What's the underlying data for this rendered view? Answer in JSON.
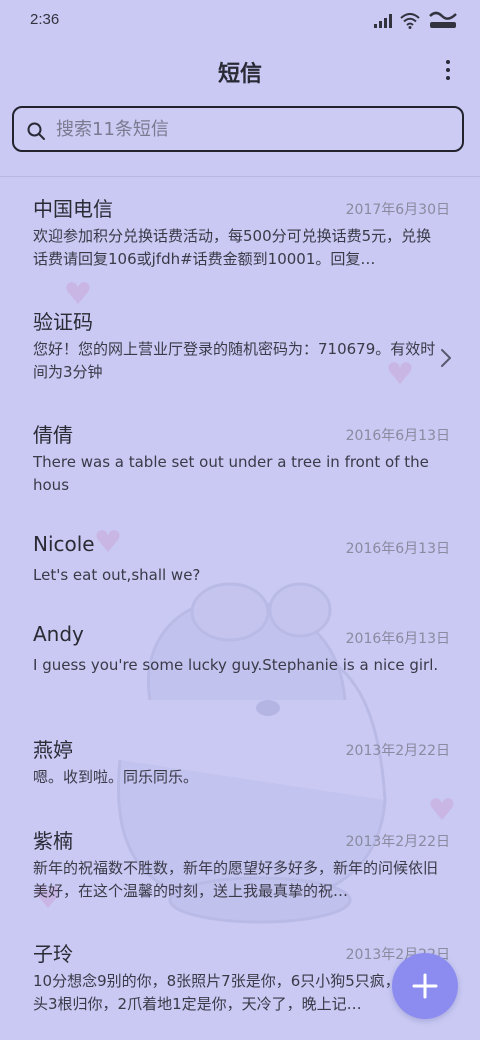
{
  "status_bar": {
    "time": "2:36",
    "icons": [
      "signal-icon",
      "wifi-icon",
      "battery-icon"
    ]
  },
  "header": {
    "title": "短信",
    "more_icon": "more-vertical-icon"
  },
  "search": {
    "placeholder": "搜索11条短信",
    "value": ""
  },
  "messages": [
    {
      "name": "中国电信",
      "date": "2017年6月30日",
      "preview": "欢迎参加积分兑换话费活动，每500分可兑换话费5元，兑换话费请回复106或jfdh#话费金额到10001。回复…"
    },
    {
      "name": "验证码",
      "date": "",
      "preview": "您好！您的网上营业厅登录的随机密码为：710679。有效时间为3分钟",
      "has_chevron": true
    },
    {
      "name": "倩倩",
      "date": "2016年6月13日",
      "preview": "There was a table set out under a tree in front of the hous"
    },
    {
      "name": "Nicole",
      "date": "2016年6月13日",
      "preview": "Let's eat out,shall we?"
    },
    {
      "name": "Andy",
      "date": "2016年6月13日",
      "preview": "I guess you're some lucky guy.Stephanie is a nice girl."
    },
    {
      "name": "燕婷",
      "date": "2013年2月22日",
      "preview": "嗯。收到啦。同乐同乐。"
    },
    {
      "name": "紫楠",
      "date": "2013年2月22日",
      "preview": "新年的祝福数不胜数，新年的愿望好多好多，新年的问候依旧美好，在这个温馨的时刻，送上我最真挚的祝…"
    },
    {
      "name": "子玲",
      "date": "2013年2月22日",
      "preview": "10分想念9别的你，8张照片7张是你，6只小狗5只疯，4根骨头3根归你，2爪着地1定是你，天冷了，晚上记…"
    }
  ],
  "fab": {
    "icon": "plus-icon"
  },
  "colors": {
    "background": "#c9c9f3",
    "accent": "#8c8cf0",
    "text_primary": "#2b2b36",
    "text_secondary": "#8a8aa0"
  }
}
